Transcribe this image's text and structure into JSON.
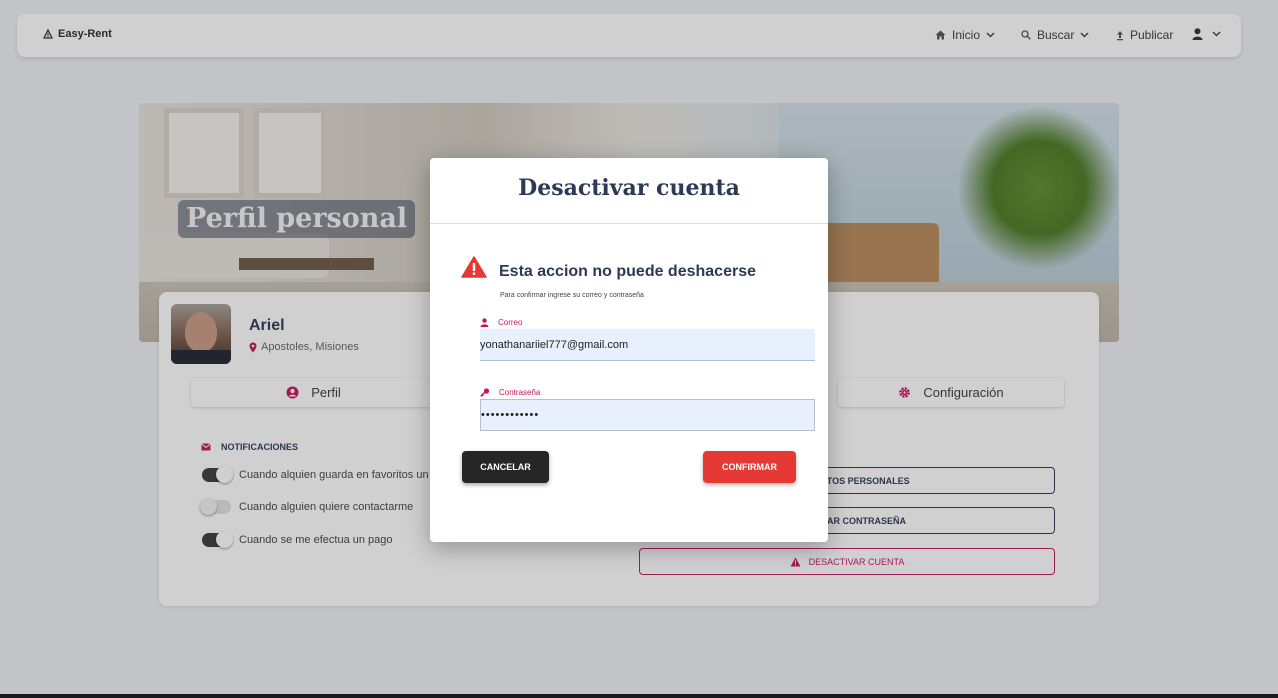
{
  "navbar": {
    "brand": "Easy-Rent",
    "items": [
      {
        "label": "Inicio",
        "icon": "home-icon"
      },
      {
        "label": "Buscar",
        "icon": "search-icon"
      },
      {
        "label": "Publicar",
        "icon": "upload-icon"
      }
    ],
    "user_icon": "user-icon"
  },
  "banner": {
    "title": "Perfil personal"
  },
  "profile": {
    "name": "Ariel",
    "location": "Apostoles, Misiones"
  },
  "tabs": [
    {
      "label": "Perfil",
      "icon": "user-circle-icon"
    },
    {
      "label": "Configuración",
      "icon": "gear-icon"
    }
  ],
  "notifications": {
    "section_label": "NOTIFICACIONES",
    "toggles": [
      {
        "label": "Cuando alquien guarda en favoritos un",
        "on": true
      },
      {
        "label": "Cuando alguien quiere contactarme",
        "on": false
      },
      {
        "label": "Cuando se me efectua un pago",
        "on": true
      }
    ]
  },
  "account_buttons": {
    "personal_data": "DATOS PERSONALES",
    "change_password": "BIAR CONTRASEÑA",
    "deactivate": "DESACTIVAR CUENTA"
  },
  "modal": {
    "title": "Desactivar cuenta",
    "warning_title": "Esta accion no puede deshacerse",
    "warning_subtitle": "Para confirmar ingrese su correo y contraseña",
    "email_label": "Correo",
    "email_value": "yonathanariiel777@gmail.com",
    "password_label": "Contraseña",
    "password_value": "••••••••••••",
    "cancel_label": "CANCELAR",
    "confirm_label": "CONFIRMAR"
  },
  "colors": {
    "accent": "#c2185b",
    "danger": "#e53935",
    "navy": "#2c3a55"
  }
}
